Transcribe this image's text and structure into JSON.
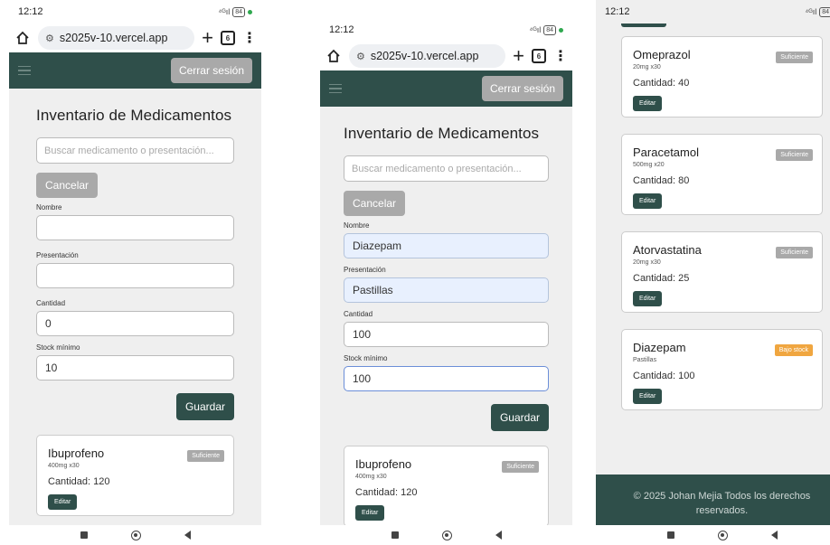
{
  "status": {
    "time": "12:12",
    "battery": "84"
  },
  "browser": {
    "url": "s2025v-10.vercel.app",
    "tab_count": "6"
  },
  "nav": {
    "logout_label": "Cerrar sesión"
  },
  "form": {
    "title": "Inventario de Medicamentos",
    "search_placeholder": "Buscar medicamento o presentación...",
    "cancel_label": "Cancelar",
    "name_label": "Nombre",
    "presentation_label": "Presentación",
    "quantity_label": "Cantidad",
    "min_stock_label": "Stock mínimo",
    "save_label": "Guardar"
  },
  "screen1": {
    "name_value": "",
    "presentation_value": "",
    "quantity_value": "0",
    "min_stock_value": "10"
  },
  "screen2": {
    "name_value": "Diazepam",
    "presentation_value": "Pastillas",
    "quantity_value": "100",
    "min_stock_value": "100"
  },
  "medicines": [
    {
      "name": "Ibuprofeno",
      "presentation": "400mg x30",
      "quantity_text": "Cantidad: 120",
      "status": "Suficiente",
      "edit_label": "Editar"
    },
    {
      "name": "Omeprazol",
      "presentation": "20mg x30",
      "quantity_text": "Cantidad: 40",
      "status": "Suficiente",
      "edit_label": "Editar"
    },
    {
      "name": "Paracetamol",
      "presentation": "500mg x20",
      "quantity_text": "Cantidad: 80",
      "status": "Suficiente",
      "edit_label": "Editar"
    },
    {
      "name": "Atorvastatina",
      "presentation": "20mg x30",
      "quantity_text": "Cantidad: 25",
      "status": "Suficiente",
      "edit_label": "Editar"
    },
    {
      "name": "Diazepam",
      "presentation": "Pastillas",
      "quantity_text": "Cantidad: 100",
      "status": "Bajo stock",
      "edit_label": "Editar"
    }
  ],
  "footer": {
    "text": "© 2025 Johan Mejia Todos los derechos reservados."
  },
  "colors": {
    "primary": "#2f4f4a",
    "muted_button": "#a9a9a9",
    "low_stock": "#f0a640",
    "page_bg": "#efefef"
  }
}
